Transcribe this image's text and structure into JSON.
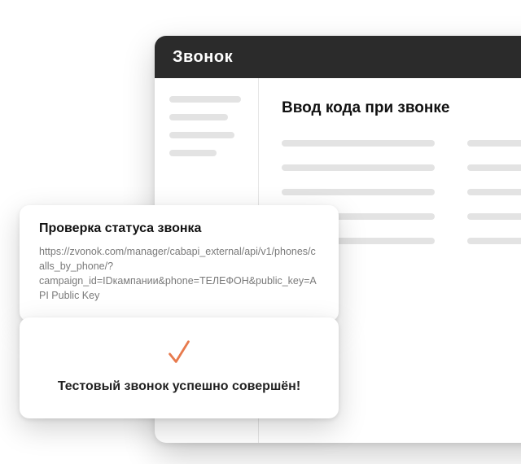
{
  "brand": "Звонок",
  "main": {
    "title": "Ввод кода при звонке"
  },
  "status_card": {
    "title": "Проверка статуса звонка",
    "url": "https://zvonok.com/manager/cabapi_external/api/v1/phones/calls_by_phone/?campaign_id=IDкампании&phone=ТЕЛЕФОН&public_key=API Public Key"
  },
  "success_card": {
    "message": "Тестовый звонок успешно совершён!"
  },
  "colors": {
    "accent": "#e77a4d"
  }
}
